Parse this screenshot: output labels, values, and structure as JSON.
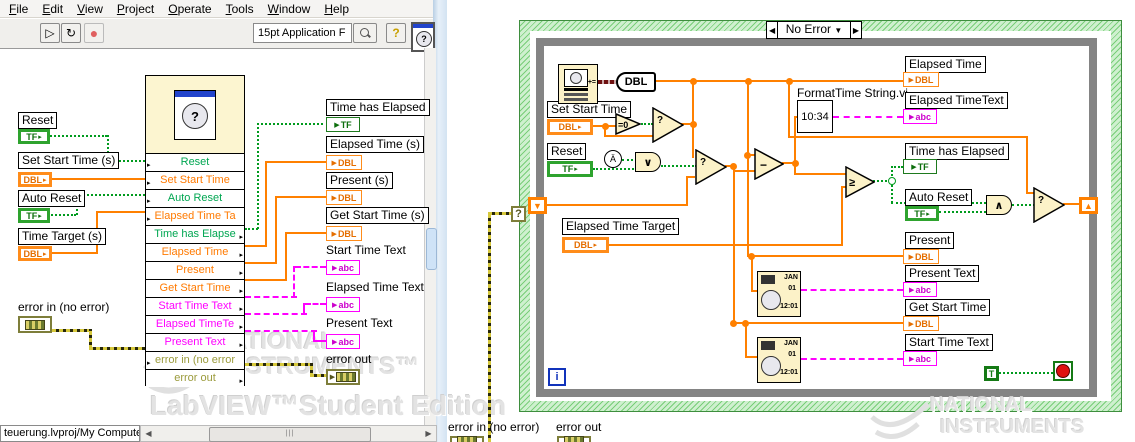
{
  "menu": {
    "items": [
      "File",
      "Edit",
      "View",
      "Project",
      "Operate",
      "Tools",
      "Window",
      "Help"
    ]
  },
  "toolbar": {
    "font_selector": "15pt Application F",
    "help_label": "?"
  },
  "statusbar": {
    "project": "teuerung.lvproj/My Computer"
  },
  "glyphs": {
    "tf": "TF",
    "dbl": "DBL",
    "abc": "abc",
    "arrow": "▶",
    "run": "▷",
    "continuous": "↻",
    "abort": "●",
    "sr_down": "▼",
    "sr_up": "▲",
    "question": "?",
    "iteration": "i",
    "true_const": "T",
    "sel_left": "◀",
    "sel_right": "▶",
    "sel_down": "▼",
    "in_mark": "▸",
    "out_mark": "▸",
    "grip": "|||",
    "up": "▲",
    "down": "▼",
    "left": "◀",
    "right": "▶"
  },
  "left": {
    "controls": {
      "reset": "Reset",
      "set_start_time": "Set Start Time (s)",
      "auto_reset": "Auto Reset",
      "time_target": "Time Target (s)",
      "error_in": "error in (no error)"
    },
    "indicators": {
      "time_has_elapsed": "Time has Elapsed",
      "elapsed_time": "Elapsed Time (s)",
      "present": "Present (s)",
      "get_start_time": "Get Start Time (s)",
      "start_time_text": "Start Time Text",
      "elapsed_time_text": "Elapsed Time Text",
      "present_text": "Present Text",
      "error_out": "error out"
    },
    "subvi": {
      "rows": [
        {
          "label": "Reset"
        },
        {
          "label": "Set Start Time"
        },
        {
          "label": "Auto Reset"
        },
        {
          "label": "Elapsed Time Ta"
        },
        {
          "label": "Time has Elapse"
        },
        {
          "label": "Elapsed Time"
        },
        {
          "label": "Present"
        },
        {
          "label": "Get Start Time"
        },
        {
          "label": "Start Time Text"
        },
        {
          "label": "Elapsed TimeTe"
        },
        {
          "label": "Present Text"
        },
        {
          "label": "error in (no error"
        },
        {
          "label": "error out"
        }
      ],
      "icon_glyph": "?"
    },
    "watermark": {
      "line1": "NATIONAL",
      "line2": "INSTRUMENTS™",
      "line3": "LabVIEW™Student Edition"
    }
  },
  "right": {
    "case_selector": "No Error",
    "labels": {
      "set_start_time": "Set Start Time",
      "reset": "Reset",
      "elapsed_time_target": "Elapsed Time Target",
      "format_time_vi": "FormatTime String.vi",
      "format_display": "10:34",
      "elapsed_time": "Elapsed Time",
      "elapsed_time_text": "Elapsed TimeText",
      "time_has_elapsed": "Time has Elapsed",
      "auto_reset": "Auto Reset",
      "present": "Present",
      "present_text": "Present Text",
      "get_start_time": "Get Start Time",
      "start_time_text": "Start Time Text",
      "error_in": "error in (no error)",
      "error_out": "error out"
    },
    "nodes": {
      "to_dbl": "DBL",
      "equal_zero": "=0",
      "select": "?",
      "first_call": "Ä",
      "or": "∨",
      "and": "∧",
      "subtract": "−",
      "gte": "≥",
      "plus_eq": "+="
    },
    "datetime_icon": {
      "month": "JAN",
      "day": "01",
      "time": "12:01"
    },
    "watermark": {
      "line1": "NATIONAL",
      "line2": "INSTRUMENTS"
    }
  },
  "colors": {
    "wire_orange": "#FF8000",
    "wire_green": "#009B1E",
    "wire_pink": "#FF00FF",
    "error_olive": "#7E7E3A",
    "case_green": "#79CE79",
    "loop_gray": "#848484",
    "node_cream": "#FCF2C8",
    "subvi_cream": "#FCF5D0"
  }
}
